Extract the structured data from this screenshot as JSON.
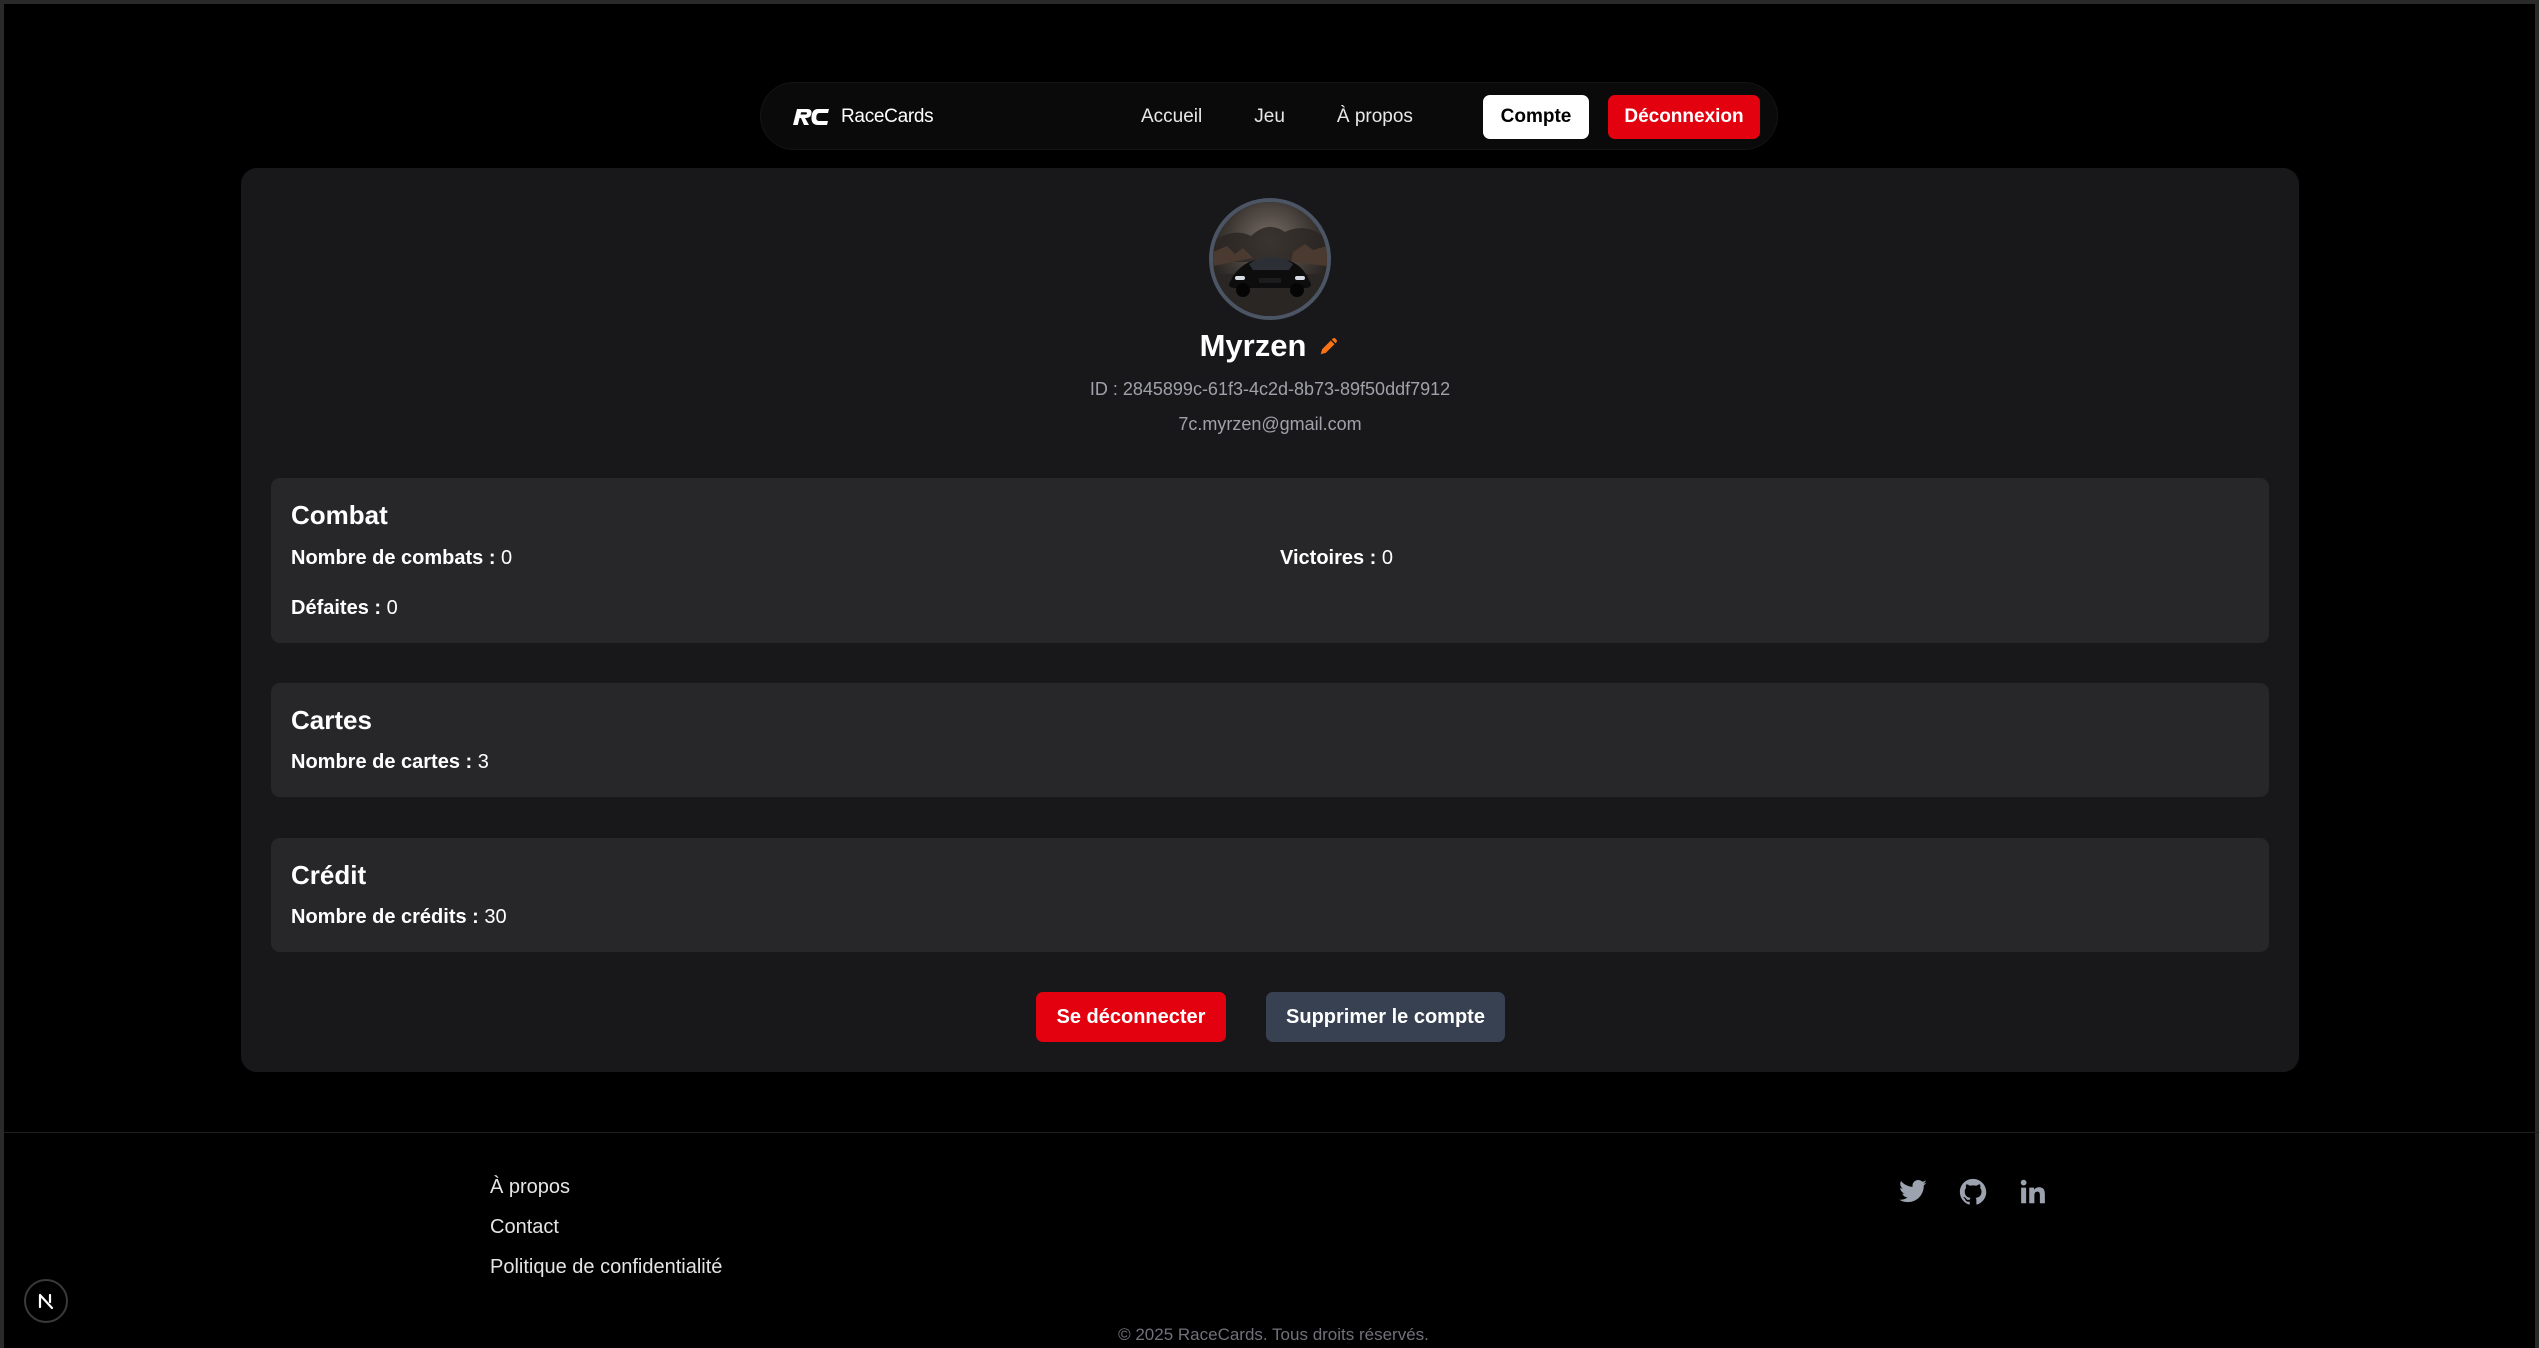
{
  "nav": {
    "brand_name": "RaceCards",
    "links": [
      "Accueil",
      "Jeu",
      "À propos"
    ],
    "account_label": "Compte",
    "logout_label": "Déconnexion"
  },
  "profile": {
    "username": "Myrzen",
    "id_text": "ID : 2845899c-61f3-4c2d-8b73-89f50ddf7912",
    "email": "7c.myrzen@gmail.com"
  },
  "sections": {
    "combat": {
      "title": "Combat",
      "fights_label": "Nombre de combats :",
      "fights_value": "0",
      "wins_label": "Victoires :",
      "wins_value": "0",
      "losses_label": "Défaites :",
      "losses_value": "0"
    },
    "cards": {
      "title": "Cartes",
      "count_label": "Nombre de cartes :",
      "count_value": "3"
    },
    "credit": {
      "title": "Crédit",
      "count_label": "Nombre de crédits :",
      "count_value": "30"
    }
  },
  "actions": {
    "logout_label": "Se déconnecter",
    "delete_label": "Supprimer le compte"
  },
  "footer": {
    "links": [
      "À propos",
      "Contact",
      "Politique de confidentialité"
    ],
    "socials": [
      "twitter-icon",
      "github-icon",
      "linkedin-icon"
    ],
    "copyright": "© 2025 RaceCards. Tous droits réservés."
  },
  "colors": {
    "accent_red": "#e3000f",
    "card_bg": "#18181b",
    "section_bg": "#27272a",
    "edit_icon": "#f97316"
  }
}
